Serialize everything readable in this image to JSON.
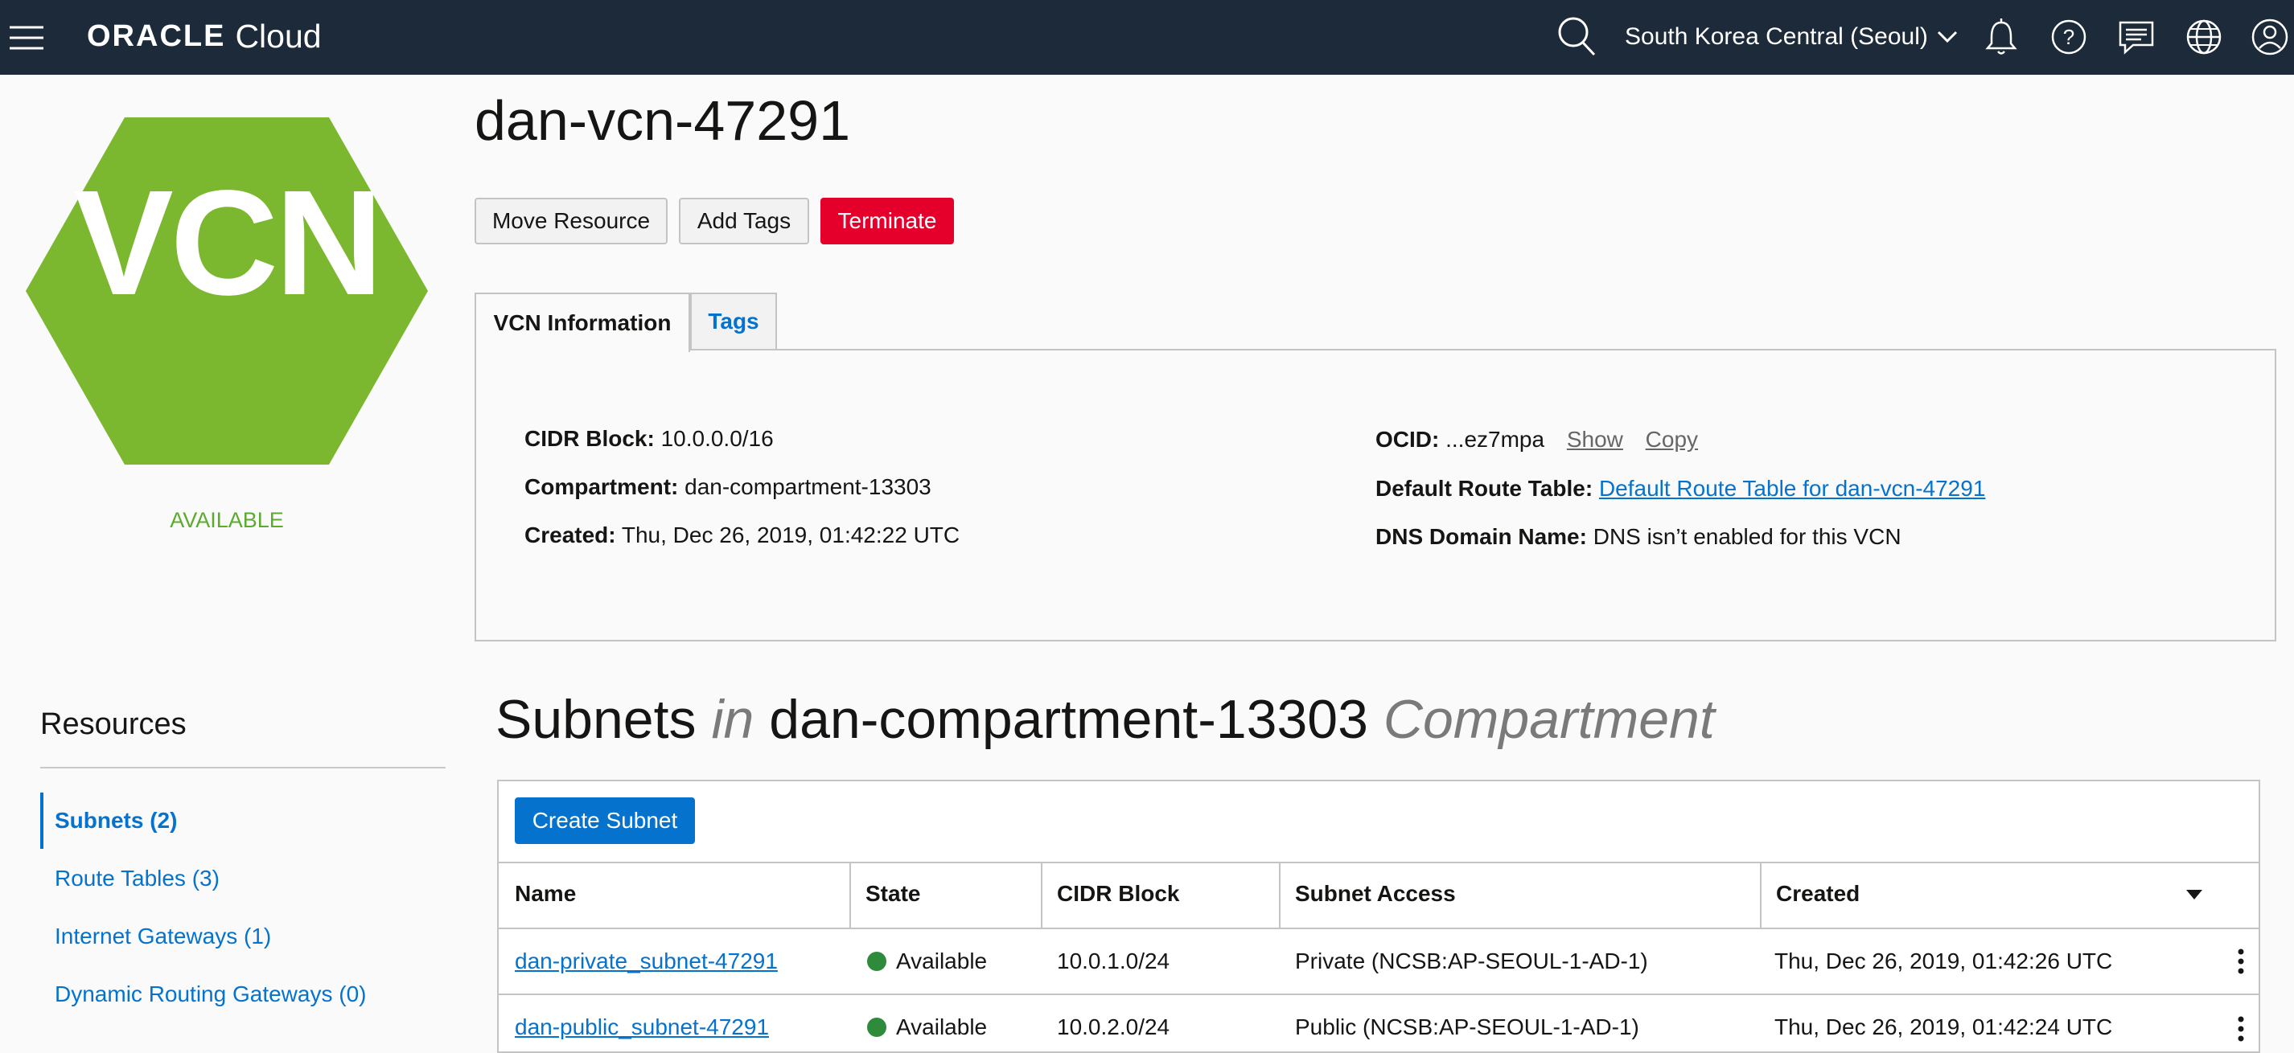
{
  "topbar": {
    "logo_oracle": "ORACLE",
    "logo_cloud": "Cloud",
    "region": "South Korea Central (Seoul)",
    "icons": [
      "menu-icon",
      "search-icon",
      "chevron-down-icon",
      "bell-icon",
      "help-icon",
      "chat-icon",
      "globe-icon",
      "user-icon"
    ]
  },
  "resource": {
    "badge_text": "VCN",
    "badge_color": "#7cb82f",
    "status": "AVAILABLE",
    "title": "dan-vcn-47291"
  },
  "actions": {
    "move": "Move Resource",
    "add_tags": "Add Tags",
    "terminate": "Terminate"
  },
  "tabs": [
    "VCN Information",
    "Tags"
  ],
  "info": {
    "cidr_label": "CIDR Block:",
    "cidr_value": "10.0.0.0/16",
    "compartment_label": "Compartment:",
    "compartment_value": "dan-compartment-13303",
    "created_label": "Created:",
    "created_value": "Thu, Dec 26, 2019, 01:42:22 UTC",
    "ocid_label": "OCID:",
    "ocid_value": "...ez7mpa",
    "ocid_show": "Show",
    "ocid_copy": "Copy",
    "route_label": "Default Route Table:",
    "route_value": "Default Route Table for dan-vcn-47291",
    "dns_label": "DNS Domain Name:",
    "dns_value": "DNS isn’t enabled for this VCN"
  },
  "resources": {
    "title": "Resources",
    "items": [
      "Subnets (2)",
      "Route Tables (3)",
      "Internet Gateways (1)",
      "Dynamic Routing Gateways (0)"
    ]
  },
  "subnets": {
    "title_main": "Subnets",
    "title_in": "in",
    "title_compartment": "dan-compartment-13303",
    "title_suffix": "Compartment",
    "create_label": "Create Subnet",
    "columns": [
      "Name",
      "State",
      "CIDR Block",
      "Subnet Access",
      "Created"
    ],
    "rows": [
      {
        "name": "dan-private_subnet-47291",
        "state": "Available",
        "cidr": "10.0.1.0/24",
        "access": "Private (NCSB:AP-SEOUL-1-AD-1)",
        "created": "Thu, Dec 26, 2019, 01:42:26 UTC"
      },
      {
        "name": "dan-public_subnet-47291",
        "state": "Available",
        "cidr": "10.0.2.0/24",
        "access": "Public (NCSB:AP-SEOUL-1-AD-1)",
        "created": "Thu, Dec 26, 2019, 01:42:24 UTC"
      }
    ],
    "state_color": "#2e8b3b"
  }
}
